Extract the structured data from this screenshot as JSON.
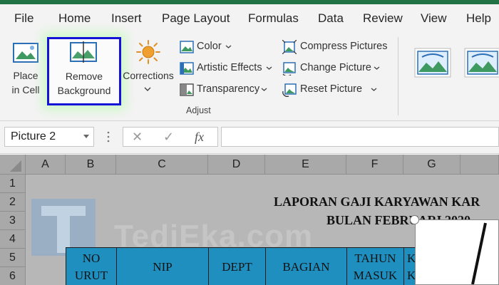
{
  "menu": {
    "items": [
      "File",
      "Home",
      "Insert",
      "Page Layout",
      "Formulas",
      "Data",
      "Review",
      "View",
      "Help"
    ]
  },
  "ribbon": {
    "place_in_cell": [
      "Place",
      "in Cell"
    ],
    "remove_background": [
      "Remove",
      "Background"
    ],
    "corrections": "Corrections",
    "color": "Color",
    "artistic_effects": "Artistic Effects",
    "transparency": "Transparency",
    "compress_pictures": "Compress Pictures",
    "change_picture": "Change Picture",
    "reset_picture": "Reset Picture",
    "group_label": "Adjust"
  },
  "formula_bar": {
    "name_box": "Picture 2",
    "cancel_symbol": "✕",
    "enter_symbol": "✓",
    "fx_symbol": "fx",
    "formula_value": ""
  },
  "sheet": {
    "columns": [
      "A",
      "B",
      "C",
      "D",
      "E",
      "F",
      "G"
    ],
    "rows": [
      "1",
      "2",
      "3",
      "4",
      "5",
      "6"
    ],
    "title_line1": "LAPORAN GAJI KARYAWAN KAR",
    "title_line2": "BULAN FEBRUARI 2020",
    "headers": [
      [
        "NO",
        "URUT"
      ],
      [
        "NIP"
      ],
      [
        "DEPT"
      ],
      [
        "BAGIAN"
      ],
      [
        "TAHUN",
        "MASUK"
      ],
      [
        "K",
        "K"
      ]
    ],
    "watermark_text": "TediEka.com"
  },
  "colors": {
    "brand_green": "#217346",
    "selection_border": "#1414d8",
    "table_header_fill": "#1f8fc0"
  }
}
